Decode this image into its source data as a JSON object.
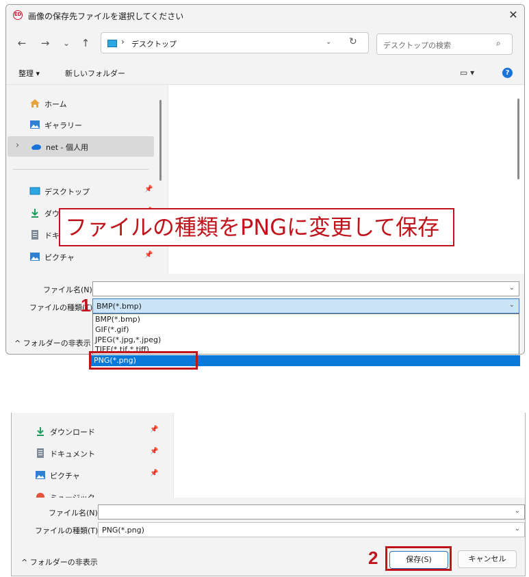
{
  "dialog": {
    "title": "画像の保存先ファイルを選択してください",
    "app_icon_text": "ED",
    "close_glyph": "✕"
  },
  "nav_buttons": {
    "back": "←",
    "forward": "→",
    "recent": "⌄",
    "up": "↑"
  },
  "address": {
    "chevron": "›",
    "path": "デスクトップ",
    "dropdown": "⌄",
    "refresh": "↻"
  },
  "search": {
    "placeholder": "デスクトップの検索",
    "icon": "⌕"
  },
  "command_bar": {
    "organize": "整理 ▾",
    "new_folder": "新しいフォルダー",
    "view_glyph": "▭ ▾",
    "help": "?"
  },
  "nav_pane": {
    "items": [
      {
        "label": "ホーム",
        "icon": "home-icon"
      },
      {
        "label": "ギャラリー",
        "icon": "gallery-icon"
      },
      {
        "label": "net - 個人用",
        "icon": "cloud-icon",
        "expand": "›",
        "selected": true
      }
    ],
    "quick_access": [
      {
        "label": "デスクトップ",
        "icon": "desktop-icon",
        "pin": "📌"
      },
      {
        "label": "ダウンロード",
        "icon": "download-icon",
        "pin": "📌"
      },
      {
        "label": "ドキュメント",
        "icon": "document-icon",
        "pin": "📌"
      },
      {
        "label": "ピクチャ",
        "icon": "pictures-icon",
        "pin": "📌"
      },
      {
        "label": "ミュージック",
        "icon": "music-icon",
        "pin": "📌"
      }
    ]
  },
  "form": {
    "filename_label": "ファイル名(N):",
    "filename_value": "",
    "filetype_label": "ファイルの種類(T):",
    "filetype_value_top": "BMP(*.bmp)",
    "filetype_value_bottom": "PNG(*.png)",
    "dd_glyph": "⌄"
  },
  "filetype_options": [
    "BMP(*.bmp)",
    "GIF(*.gif)",
    "JPEG(*.jpg,*.jpeg)",
    "TIFF(*.tif,*.tiff)",
    "PNG(*.png)"
  ],
  "hide_folders": "^ フォルダーの非表示",
  "buttons": {
    "save": "保存(S)",
    "cancel": "キャンセル"
  },
  "annotations": {
    "callout": "ファイルの種類をPNGに変更して保存",
    "step1": "1",
    "step2": "2",
    "accent_color": "#c0141c",
    "selection_color": "#0a78d7"
  }
}
